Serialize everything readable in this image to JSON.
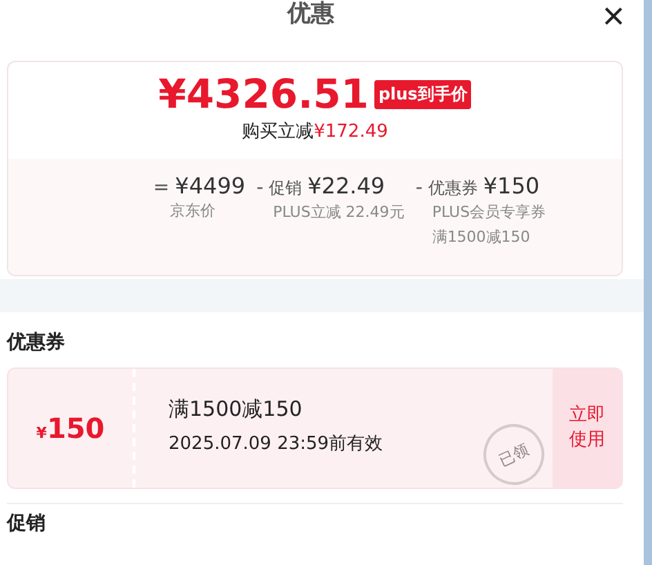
{
  "header": {
    "title": "优惠",
    "close": "×"
  },
  "summary": {
    "price": "¥4326.51",
    "price_tag": "plus到手价",
    "saving_label": "购买立减",
    "saving_amount": "¥172.49",
    "breakdown": [
      {
        "op": "=",
        "amount": "¥4499",
        "notes": [
          "京东价"
        ]
      },
      {
        "op": "-",
        "label": "促销",
        "amount": "¥22.49",
        "notes": [
          "PLUS立减 22.49元"
        ]
      },
      {
        "op": "-",
        "label": "优惠券",
        "amount": "¥150",
        "notes": [
          "PLUS会员专享券",
          "满1500减150"
        ]
      }
    ]
  },
  "coupons_section": {
    "title": "优惠券",
    "coupons": [
      {
        "currency": "¥",
        "value": "150",
        "condition": "满1500减150",
        "validity": "2025.07.09 23:59前有效",
        "stamp": "已领",
        "action": "立即使用"
      }
    ]
  },
  "promo_section": {
    "title": "促销"
  }
}
